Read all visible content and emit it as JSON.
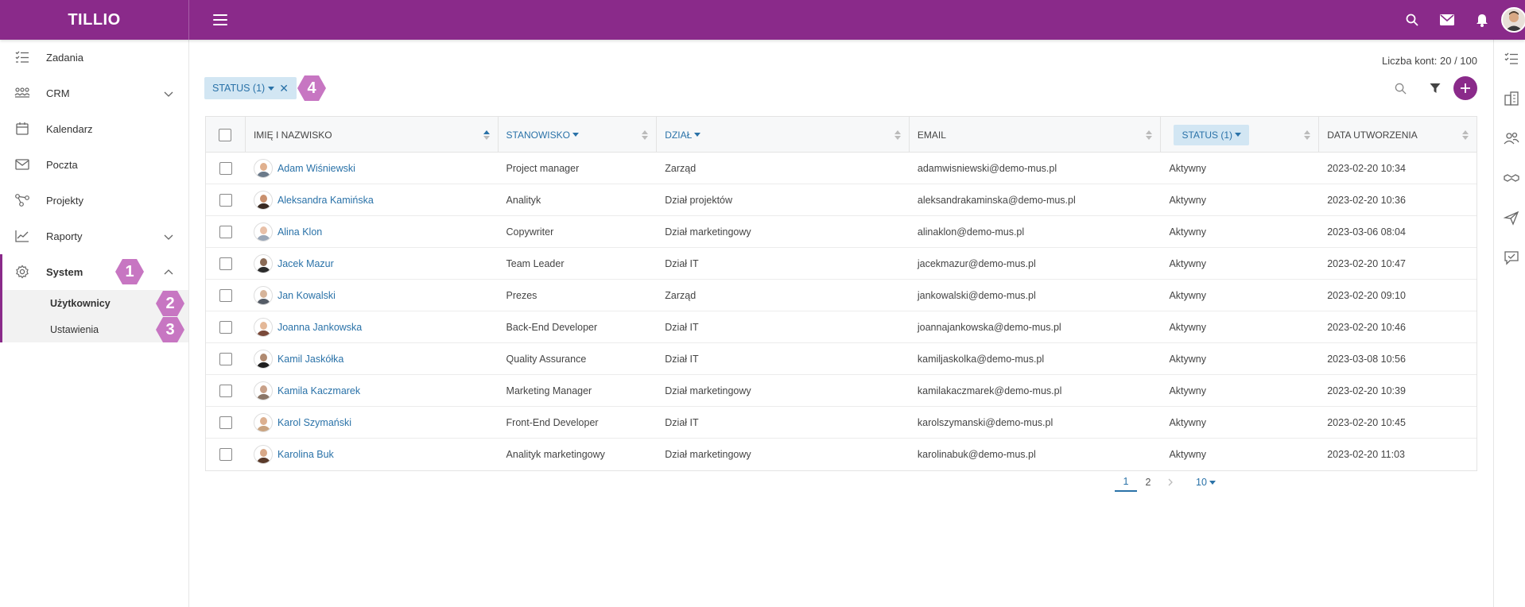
{
  "app": {
    "brand": "TILLIO"
  },
  "colors": {
    "primary": "#8a2a8a",
    "link": "#2a72a8",
    "chip_bg": "#d2e6f3",
    "callout": "#c776c2"
  },
  "topbar": {
    "icons": [
      "search-icon",
      "mail-icon",
      "bell-icon",
      "user-avatar"
    ]
  },
  "sidebar": {
    "items": [
      {
        "label": "Zadania",
        "icon": "tasks-icon"
      },
      {
        "label": "CRM",
        "icon": "crm-icon",
        "expandable": true
      },
      {
        "label": "Kalendarz",
        "icon": "calendar-icon"
      },
      {
        "label": "Poczta",
        "icon": "mail-icon"
      },
      {
        "label": "Projekty",
        "icon": "projects-icon"
      },
      {
        "label": "Raporty",
        "icon": "chart-icon",
        "expandable": true
      },
      {
        "label": "System",
        "icon": "gear-icon",
        "expandable": true,
        "expanded": true
      }
    ],
    "subitems": [
      {
        "label": "Użytkownicy",
        "selected": true
      },
      {
        "label": "Ustawienia"
      }
    ]
  },
  "callouts": [
    "1",
    "2",
    "3",
    "4"
  ],
  "rail": {
    "icons": [
      "tasks-icon",
      "buildings-icon",
      "people-icon",
      "handshake-icon",
      "send-icon",
      "comment-check-icon"
    ]
  },
  "main": {
    "account_count": "Liczba kont: 20 / 100",
    "filter_chip": "STATUS (1)",
    "table": {
      "columns": [
        "IMIĘ I NAZWISKO",
        "STANOWISKO",
        "DZIAŁ",
        "EMAIL",
        "STATUS (1)",
        "DATA UTWORZENIA"
      ],
      "rows": [
        {
          "name": "Adam Wiśniewski",
          "position": "Project manager",
          "department": "Zarząd",
          "email": "adamwisniewski@demo-mus.pl",
          "status": "Aktywny",
          "created": "2023-02-20 10:34"
        },
        {
          "name": "Aleksandra Kamińska",
          "position": "Analityk",
          "department": "Dział projektów",
          "email": "aleksandrakaminska@demo-mus.pl",
          "status": "Aktywny",
          "created": "2023-02-20 10:36"
        },
        {
          "name": "Alina Klon",
          "position": "Copywriter",
          "department": "Dział marketingowy",
          "email": "alinaklon@demo-mus.pl",
          "status": "Aktywny",
          "created": "2023-03-06 08:04"
        },
        {
          "name": "Jacek Mazur",
          "position": "Team Leader",
          "department": "Dział IT",
          "email": "jacekmazur@demo-mus.pl",
          "status": "Aktywny",
          "created": "2023-02-20 10:47"
        },
        {
          "name": "Jan Kowalski",
          "position": "Prezes",
          "department": "Zarząd",
          "email": "jankowalski@demo-mus.pl",
          "status": "Aktywny",
          "created": "2023-02-20 09:10"
        },
        {
          "name": "Joanna Jankowska",
          "position": "Back-End Developer",
          "department": "Dział IT",
          "email": "joannajankowska@demo-mus.pl",
          "status": "Aktywny",
          "created": "2023-02-20 10:46"
        },
        {
          "name": "Kamil Jaskółka",
          "position": "Quality Assurance",
          "department": "Dział IT",
          "email": "kamiljaskolka@demo-mus.pl",
          "status": "Aktywny",
          "created": "2023-03-08 10:56"
        },
        {
          "name": "Kamila Kaczmarek",
          "position": "Marketing Manager",
          "department": "Dział marketingowy",
          "email": "kamilakaczmarek@demo-mus.pl",
          "status": "Aktywny",
          "created": "2023-02-20 10:39"
        },
        {
          "name": "Karol Szymański",
          "position": "Front-End Developer",
          "department": "Dział IT",
          "email": "karolszymanski@demo-mus.pl",
          "status": "Aktywny",
          "created": "2023-02-20 10:45"
        },
        {
          "name": "Karolina Buk",
          "position": "Analityk marketingowy",
          "department": "Dział marketingowy",
          "email": "karolinabuk@demo-mus.pl",
          "status": "Aktywny",
          "created": "2023-02-20 11:03"
        }
      ]
    },
    "pagination": {
      "pages": [
        "1",
        "2"
      ],
      "current": "1",
      "page_size": "10"
    }
  }
}
